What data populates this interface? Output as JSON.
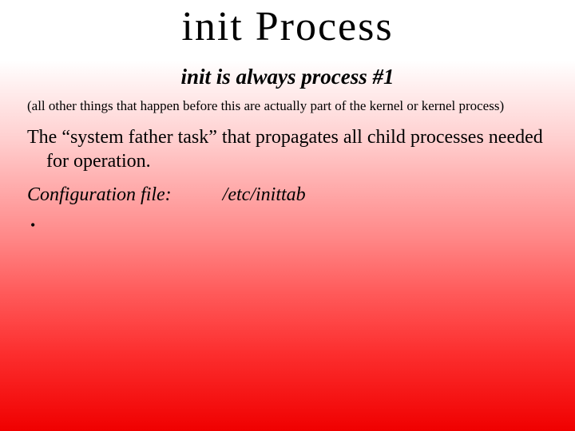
{
  "slide": {
    "title": "init Process",
    "subtitle": "init is always process #1",
    "paren": "(all other things that happen before this are actually part of the kernel or kernel process)",
    "body": "The “system father task” that propagates all child processes needed for operation.",
    "config_label": "Configuration file:",
    "config_value": "/etc/inittab",
    "bullet": "•"
  }
}
